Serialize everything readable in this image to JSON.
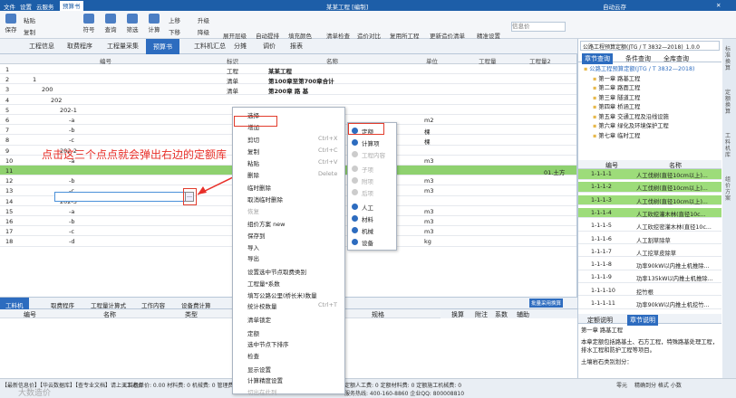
{
  "titlebar": {
    "menu": [
      "文件",
      "设置",
      "云服务",
      "预算书"
    ],
    "title": "某某工程 [编制]",
    "right": "自动云存",
    "user": "—"
  },
  "ribbon": {
    "buttons": [
      "保存",
      "粘贴",
      "复制",
      "符号",
      "查询",
      "筛选",
      "计算"
    ],
    "small": [
      "上移",
      "下移",
      "升级",
      "降级",
      "展开层级",
      "自动提排",
      "填充颜色",
      "清单检查",
      "造价对比",
      "复用所工程",
      "更新造价清单",
      "精准设置"
    ],
    "search_placeholder": "信息价"
  },
  "tabs": [
    "工程信息",
    "取费程序",
    "工程量采集",
    "预算书",
    "工料机汇总",
    "分摊",
    "调价",
    "报表"
  ],
  "grid": {
    "headers": [
      "编号",
      "标识",
      "名称",
      "单位",
      "工程量",
      "工程量2"
    ],
    "rows": [
      {
        "n": "1",
        "code": "",
        "tag": "工程",
        "name": "某某工程",
        "unit": ""
      },
      {
        "n": "2",
        "code": "1",
        "tag": "清单",
        "name": "第100章至第700章合计",
        "unit": ""
      },
      {
        "n": "3",
        "code": "200",
        "tag": "清单",
        "name": "第200章 路 基",
        "unit": ""
      },
      {
        "n": "4",
        "code": "202",
        "tag": "",
        "name": "",
        "unit": ""
      },
      {
        "n": "5",
        "code": "202-1",
        "tag": "",
        "name": "",
        "unit": ""
      },
      {
        "n": "6",
        "code": "-a",
        "tag": "",
        "name": "",
        "unit": "m2"
      },
      {
        "n": "7",
        "code": "-b",
        "tag": "",
        "name": "",
        "unit": "棵"
      },
      {
        "n": "8",
        "code": "-c",
        "tag": "",
        "name": "",
        "unit": "棵"
      },
      {
        "n": "9",
        "code": "202-2",
        "tag": "",
        "name": "",
        "unit": ""
      },
      {
        "n": "10",
        "code": "-a",
        "tag": "",
        "name": "",
        "unit": "m3"
      },
      {
        "n": "11",
        "code": "",
        "tag": "",
        "name": "",
        "unit": "",
        "extra": "01.土方"
      },
      {
        "n": "12",
        "code": "-b",
        "tag": "",
        "name": "",
        "unit": "m3"
      },
      {
        "n": "13",
        "code": "-c",
        "tag": "",
        "name": "",
        "unit": "m3"
      },
      {
        "n": "14",
        "code": "202-3",
        "tag": "",
        "name": "",
        "unit": ""
      },
      {
        "n": "15",
        "code": "-a",
        "tag": "",
        "name": "",
        "unit": "m3"
      },
      {
        "n": "16",
        "code": "-b",
        "tag": "",
        "name": "",
        "unit": "m3"
      },
      {
        "n": "17",
        "code": "-c",
        "tag": "",
        "name": "",
        "unit": "m3"
      },
      {
        "n": "18",
        "code": "-d",
        "tag": "",
        "name": "",
        "unit": "kg"
      }
    ]
  },
  "bottom": {
    "tabs": [
      "工料机",
      "取费程序",
      "工程量计算式",
      "工作内容",
      "设备费计算"
    ],
    "headers": [
      "编号",
      "名称",
      "类型",
      "规格"
    ],
    "right_tabs": [
      "换算",
      "附注",
      "系数",
      "辅助"
    ],
    "btn": "批量采用换算"
  },
  "menu": {
    "items": [
      {
        "label": "选择",
        "sc": "",
        "dis": false
      },
      {
        "label": "增加",
        "sc": "",
        "dis": false
      },
      {
        "label": "剪切",
        "sc": "Ctrl+X",
        "dis": false
      },
      {
        "label": "复制",
        "sc": "Ctrl+C",
        "dis": false
      },
      {
        "label": "粘贴",
        "sc": "Ctrl+V",
        "dis": false
      },
      {
        "label": "删除",
        "sc": "Delete",
        "dis": false
      },
      {
        "label": "临时删除",
        "sc": "",
        "dis": false
      },
      {
        "label": "取消临时删除",
        "sc": "",
        "dis": false
      },
      {
        "label": "恢复",
        "sc": "",
        "dis": true
      },
      {
        "label": "组价方案 new",
        "sc": "",
        "dis": false
      },
      {
        "label": "保存到",
        "sc": "",
        "dis": false
      },
      {
        "label": "导入",
        "sc": "",
        "dis": false
      },
      {
        "label": "导出",
        "sc": "",
        "dis": false
      },
      {
        "label": "设置选中节点取费类别",
        "sc": "",
        "dis": false
      },
      {
        "label": "工程量*系数",
        "sc": "",
        "dis": false
      },
      {
        "label": "填写公路公里(桥长米)数量",
        "sc": "",
        "dis": false
      },
      {
        "label": "统计校数量",
        "sc": "Ctrl+T",
        "dis": false
      },
      {
        "label": "清单锁定",
        "sc": "",
        "dis": false
      },
      {
        "label": "定额",
        "sc": "",
        "dis": false
      },
      {
        "label": "选中节点下排序",
        "sc": "",
        "dis": false
      },
      {
        "label": "检查",
        "sc": "",
        "dis": false
      },
      {
        "label": "显示设置",
        "sc": "",
        "dis": false
      },
      {
        "label": "计算精度设置",
        "sc": "",
        "dis": false
      },
      {
        "label": "切出在此列",
        "sc": "",
        "dis": true
      }
    ]
  },
  "submenu": {
    "items": [
      {
        "label": "定额",
        "dis": false
      },
      {
        "label": "计算项",
        "dis": false
      },
      {
        "label": "工程内容",
        "dis": true
      },
      {
        "label": "子项",
        "dis": true
      },
      {
        "label": "附项",
        "dis": true
      },
      {
        "label": "后项",
        "dis": true
      },
      {
        "label": "人工",
        "dis": false
      },
      {
        "label": "材料",
        "dis": false
      },
      {
        "label": "机械",
        "dis": false
      },
      {
        "label": "设备",
        "dis": false
      }
    ]
  },
  "annotation": "点击这三个点点就会弹出右边的定额库",
  "right": {
    "selector": "公路工程预算定额(JTG / T 3832—2018)_1.0.0",
    "tabs": [
      "章节查询",
      "条件查询",
      "全库查询"
    ],
    "tree": [
      "公路工程预算定额(JTG / T 3832—2018)",
      "第一章 路基工程",
      "第二章 路面工程",
      "第三章 隧道工程",
      "第四章 桥涵工程",
      "第五章 交通工程及沿线设施",
      "第六章 绿化及环境保护工程",
      "第七章 临时工程"
    ],
    "headers": [
      "编号",
      "名称"
    ],
    "rows": [
      {
        "code": "1-1-1-1",
        "name": "人工伐树(直径10cm以上)..."
      },
      {
        "code": "1-1-1-2",
        "name": "人工伐树(直径10cm以上)..."
      },
      {
        "code": "1-1-1-3",
        "name": "人工伐树(直径10cm以上)..."
      },
      {
        "code": "1-1-1-4",
        "name": "人工砍挖灌木林(直径10c..."
      },
      {
        "code": "1-1-1-5",
        "name": "人工砍挖密灌木林(直径10c..."
      },
      {
        "code": "1-1-1-6",
        "name": "人工割草除草"
      },
      {
        "code": "1-1-1-7",
        "name": "人工挖草皮除草"
      },
      {
        "code": "1-1-1-8",
        "name": "功率90kW以内推土机推除..."
      },
      {
        "code": "1-1-1-9",
        "name": "功率135kW以内推土机推除..."
      },
      {
        "code": "1-1-1-10",
        "name": "挖竹根"
      },
      {
        "code": "1-1-1-11",
        "name": "功率90kW以内推土机挖竹..."
      }
    ],
    "bottom_tabs": [
      "定额说明",
      "章节说明"
    ],
    "desc": [
      "第一章 路基工程",
      "本章定额包括路基土、石方工程，特殊路基处理工程，排水工程和防护工程等项目。",
      "土壤岩石类别划分："
    ]
  },
  "vtabs": [
    "标准换算",
    "定额换算",
    "工料机库",
    "组价方案"
  ],
  "status": {
    "left": "【最新信息价】【华云数据库】【查专业文档】请上天工造价",
    "mid": "工料机单价: 0.00 材料费: 0 机械费: 0 管理费: 0 利",
    "right1": "定额人工费: 0 定额材料费: 0 定额施工机械费: 0",
    "hotline": "服务热线: 400-160-8860 企业QQ: 800008810",
    "zoom": "零元",
    "ctrl": "精确到分 格式 小数",
    "watermark": "大数造价"
  },
  "colors": {
    "accent": "#2d6cbf",
    "highlight": "#8fd16f",
    "annotation": "#e8302a"
  }
}
